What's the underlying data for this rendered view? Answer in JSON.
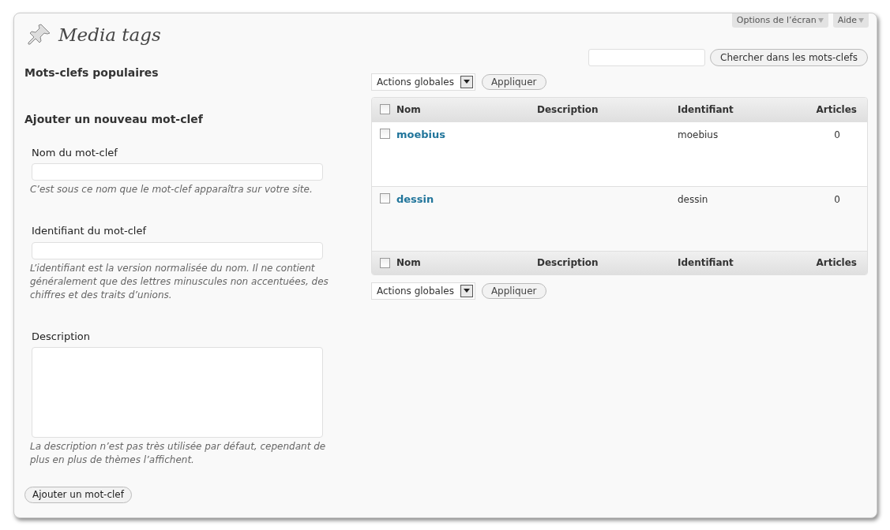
{
  "header": {
    "title": "Media tags",
    "screen_options": "Options de l’écran",
    "help": "Aide"
  },
  "search": {
    "button": "Chercher dans les mots-clefs"
  },
  "popular": {
    "heading": "Mots-clefs populaires"
  },
  "form": {
    "heading": "Ajouter un nouveau mot-clef",
    "fields": [
      {
        "kind": "input",
        "label": "Nom du mot-clef",
        "hint": "C’est sous ce nom que le mot-clef apparaîtra sur votre site."
      },
      {
        "kind": "input",
        "label": "Identifiant du mot-clef",
        "hint": "L’identifiant est la version normalisée du nom. Il ne contient généralement que des lettres minuscules non accentuées, des chiffres et des traits d’unions."
      },
      {
        "kind": "textarea",
        "label": "Description",
        "hint": "La description n’est pas très utilisée par défaut, cependant de plus en plus de thèmes l’affichent."
      }
    ],
    "submit": "Ajouter un mot-clef"
  },
  "bulk_top": {
    "select": "Actions globales",
    "apply": "Appliquer"
  },
  "table": {
    "select_all_checked": false,
    "footer_select_all_checked": false,
    "columns": [
      "Nom",
      "Description",
      "Identifiant",
      "Articles"
    ],
    "rows": [
      {
        "name": "moebius",
        "slug": "moebius",
        "count": "0",
        "checked": false
      },
      {
        "name": "dessin",
        "slug": "dessin",
        "count": "0",
        "checked": false
      }
    ],
    "footer_columns": [
      "Nom",
      "Description",
      "Identifiant",
      "Articles"
    ]
  },
  "bulk_bottom": {
    "select": "Actions globales",
    "apply": "Appliquer"
  }
}
